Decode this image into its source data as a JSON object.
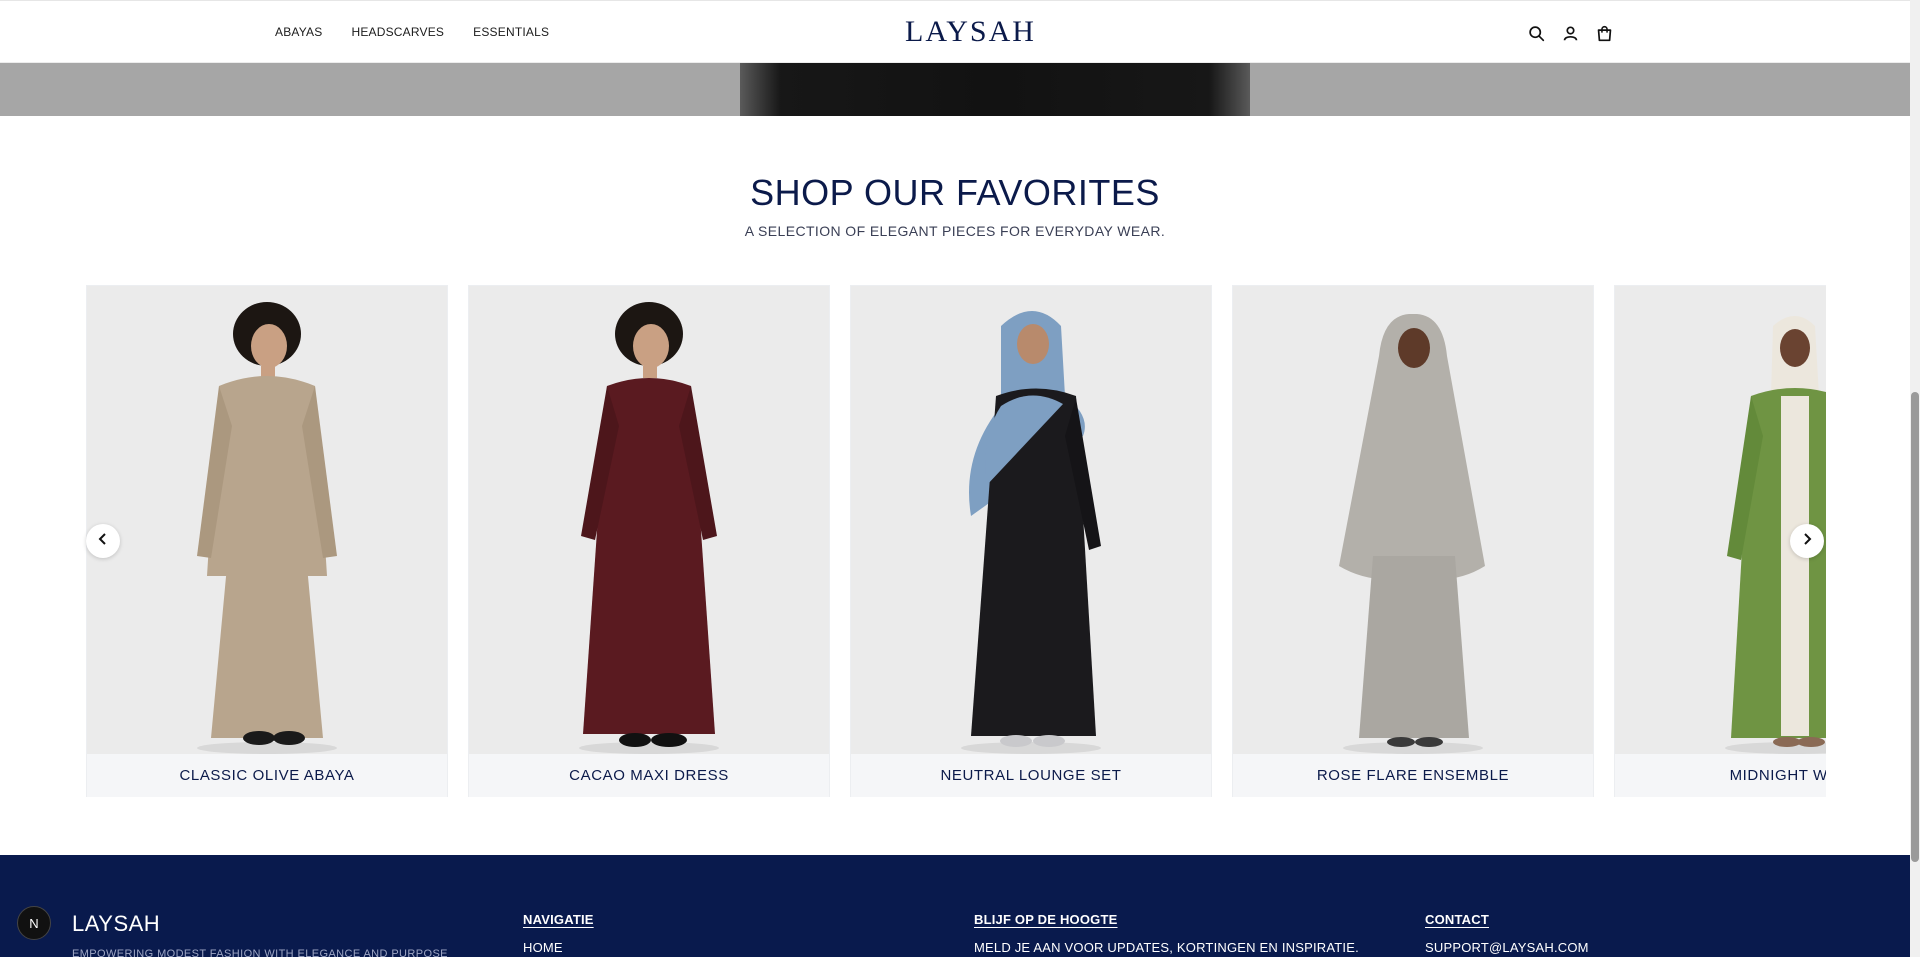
{
  "header": {
    "nav": [
      "ABAYAS",
      "HEADSCARVES",
      "ESSENTIALS"
    ],
    "logo": "LAYSAH",
    "icons": [
      "search-icon",
      "account-icon",
      "cart-icon"
    ]
  },
  "section": {
    "title": "SHOP OUR FAVORITES",
    "subtitle": "A SELECTION OF ELEGANT PIECES FOR EVERYDAY WEAR."
  },
  "products": [
    {
      "name": "CLASSIC OLIVE ABAYA",
      "garment_color": "#b8a58d",
      "skin": "#c9a083",
      "hair": "#1c1612"
    },
    {
      "name": "CACAO MAXI DRESS",
      "garment_color": "#5a1a20",
      "skin": "#c9a083",
      "hair": "#1c1612"
    },
    {
      "name": "NEUTRAL LOUNGE SET",
      "garment_color": "#1b1a1d",
      "scarf_color": "#7e9fc2",
      "skin": "#b88a6c"
    },
    {
      "name": "ROSE FLARE ENSEMBLE",
      "garment_color": "#b3b0aa",
      "skin": "#5e3a29"
    },
    {
      "name": "MIDNIGHT WRAP",
      "garment_color": "#6f9443",
      "scarf_color": "#ece7dd",
      "skin": "#6a4331"
    }
  ],
  "carousel": {
    "prev_icon": "chevron-left-icon",
    "next_icon": "chevron-right-icon"
  },
  "footer": {
    "brand": "LAYSAH",
    "tagline": "EMPOWERING MODEST FASHION WITH ELEGANCE AND PURPOSE",
    "nav_title": "NAVIGATIE",
    "nav_first": "HOME",
    "newsletter_title": "BLIJF OP DE HOOGTE",
    "newsletter_text": "MELD JE AAN VOOR UPDATES, KORTINGEN EN INSPIRATIE.",
    "contact_title": "CONTACT",
    "contact_email": "SUPPORT@LAYSAH.COM"
  },
  "fab_label": "N",
  "colors": {
    "brand": "#0b1a4a",
    "footer_bg": "#091a4d"
  }
}
